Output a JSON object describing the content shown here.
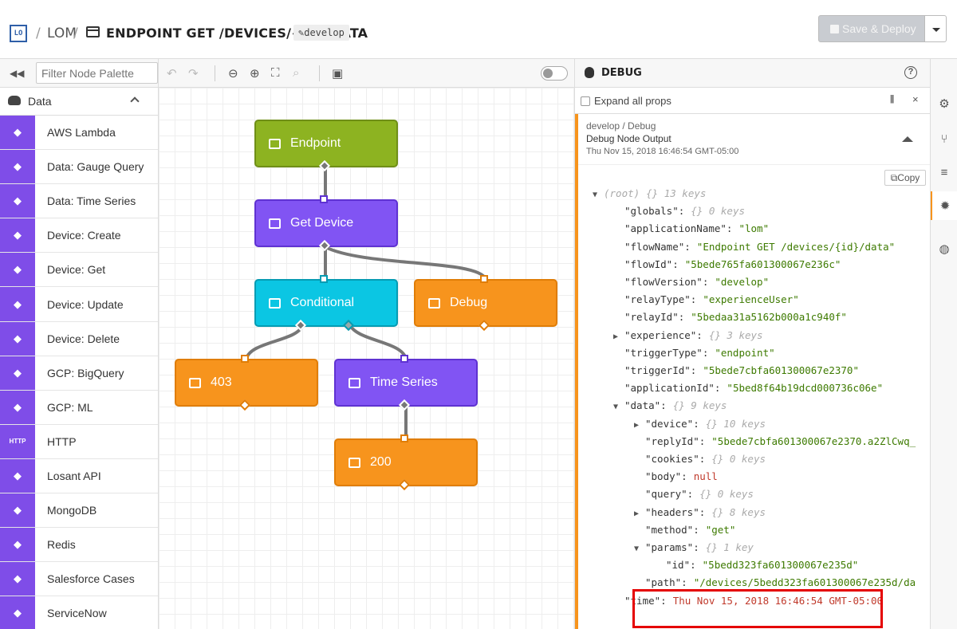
{
  "header": {
    "logo": "LO",
    "sep1": "/",
    "app_name": "LOM",
    "sep2": "/",
    "workflow_title": "ENDPOINT GET /DEVICES/{ID}/DATA",
    "branch": "develop",
    "deploy_label": "Save & Deploy"
  },
  "palette": {
    "filter_placeholder": "Filter Node Palette",
    "category": "Data",
    "items": [
      {
        "label": "AWS Lambda",
        "icon": "aws-lambda-icon"
      },
      {
        "label": "Data: Gauge Query",
        "icon": "bar-chart-icon"
      },
      {
        "label": "Data: Time Series",
        "icon": "line-chart-icon"
      },
      {
        "label": "Device: Create",
        "icon": "chip-icon"
      },
      {
        "label": "Device: Get",
        "icon": "chip-icon"
      },
      {
        "label": "Device: Update",
        "icon": "chip-icon"
      },
      {
        "label": "Device: Delete",
        "icon": "chip-icon"
      },
      {
        "label": "GCP: BigQuery",
        "icon": "bigquery-icon"
      },
      {
        "label": "GCP: ML",
        "icon": "ml-icon"
      },
      {
        "label": "HTTP",
        "icon": "http-icon",
        "icon_text": "HTTP"
      },
      {
        "label": "Losant API",
        "icon": "losant-icon"
      },
      {
        "label": "MongoDB",
        "icon": "mongodb-icon"
      },
      {
        "label": "Redis",
        "icon": "redis-icon"
      },
      {
        "label": "Salesforce Cases",
        "icon": "salesforce-icon"
      },
      {
        "label": "ServiceNow",
        "icon": "servicenow-icon"
      }
    ]
  },
  "canvas": {
    "nodes": {
      "endpoint": "Endpoint",
      "get_device": "Get Device",
      "conditional": "Conditional",
      "debug": "Debug",
      "r403": "403",
      "time_series": "Time Series",
      "r200": "200"
    }
  },
  "debug": {
    "title": "DEBUG",
    "help": "?",
    "expand_label": "Expand all props",
    "pause": "||",
    "clear": "×",
    "message": {
      "path": "develop / Debug",
      "node": "Debug Node Output",
      "time": "Thu Nov 15, 2018 16:46:54 GMT-05:00",
      "copy": "Copy"
    },
    "tree": [
      {
        "indent": 0,
        "toggle": "▼",
        "key": "(root)",
        "meta": "{}  13 keys",
        "root": true
      },
      {
        "indent": 1,
        "key": "\"globals\":",
        "meta": "{}  0 keys"
      },
      {
        "indent": 1,
        "key": "\"applicationName\":",
        "value": "\"lom\"",
        "kind": "s"
      },
      {
        "indent": 1,
        "key": "\"flowName\":",
        "value": "\"Endpoint GET /devices/{id}/data\"",
        "kind": "s"
      },
      {
        "indent": 1,
        "key": "\"flowId\":",
        "value": "\"5bede765fa601300067e236c\"",
        "kind": "s"
      },
      {
        "indent": 1,
        "key": "\"flowVersion\":",
        "value": "\"develop\"",
        "kind": "s"
      },
      {
        "indent": 1,
        "key": "\"relayType\":",
        "value": "\"experienceUser\"",
        "kind": "s"
      },
      {
        "indent": 1,
        "key": "\"relayId\":",
        "value": "\"5bedaa31a5162b000a1c940f\"",
        "kind": "s"
      },
      {
        "indent": 1,
        "toggle": "▶",
        "key": "\"experience\":",
        "meta": "{}  3 keys"
      },
      {
        "indent": 1,
        "key": "\"triggerType\":",
        "value": "\"endpoint\"",
        "kind": "s"
      },
      {
        "indent": 1,
        "key": "\"triggerId\":",
        "value": "\"5bede7cbfa601300067e2370\"",
        "kind": "s"
      },
      {
        "indent": 1,
        "key": "\"applicationId\":",
        "value": "\"5bed8f64b19dcd000736c06e\"",
        "kind": "s"
      },
      {
        "indent": 1,
        "toggle": "▼",
        "key": "\"data\":",
        "meta": "{}  9 keys"
      },
      {
        "indent": 2,
        "toggle": "▶",
        "key": "\"device\":",
        "meta": "{}  10 keys"
      },
      {
        "indent": 2,
        "key": "\"replyId\":",
        "value": "\"5bede7cbfa601300067e2370.a2ZlCwq_",
        "kind": "s"
      },
      {
        "indent": 2,
        "key": "\"cookies\":",
        "meta": "{}  0 keys"
      },
      {
        "indent": 2,
        "key": "\"body\":",
        "value": "null",
        "kind": "nl"
      },
      {
        "indent": 2,
        "key": "\"query\":",
        "meta": "{}  0 keys"
      },
      {
        "indent": 2,
        "toggle": "▶",
        "key": "\"headers\":",
        "meta": "{}  8 keys"
      },
      {
        "indent": 2,
        "key": "\"method\":",
        "value": "\"get\"",
        "kind": "s"
      },
      {
        "indent": 2,
        "toggle": "▼",
        "key": "\"params\":",
        "meta": "{}  1 key"
      },
      {
        "indent": 3,
        "key": "\"id\":",
        "value": "\"5bedd323fa601300067e235d\"",
        "kind": "s"
      },
      {
        "indent": 2,
        "key": "\"path\":",
        "value": "\"/devices/5bedd323fa601300067e235d/da",
        "kind": "s"
      },
      {
        "indent": 1,
        "key": "\"time\":",
        "value": "Thu Nov 15, 2018 16:46:54 GMT-05:00",
        "kind": "t"
      }
    ]
  },
  "rail": [
    "gear-icon",
    "branch-icon",
    "database-icon",
    "bug-icon",
    "globe-icon"
  ],
  "colors": {
    "trigger": "#8db321",
    "purple": "#8154f3",
    "cyan": "#0bc6e3",
    "orange": "#f7941d",
    "highlight": "#e50000"
  }
}
